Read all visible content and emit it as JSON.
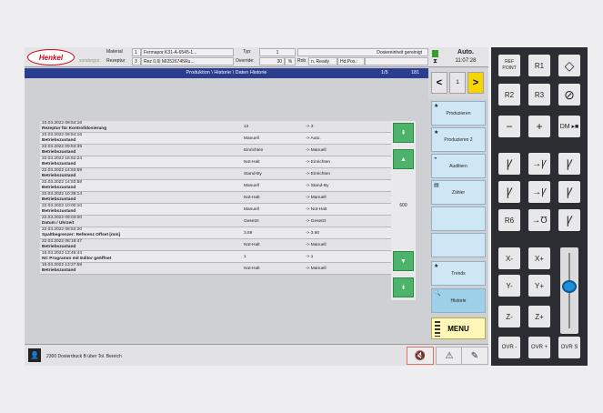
{
  "brand": {
    "logo": "Henkel",
    "sub": "sondergut"
  },
  "header": {
    "material_label": "Material",
    "material_no": "1",
    "material_value": "Fermapor K31-A-6545-1...",
    "recipe_label": "Rezeptur",
    "recipe_no": "3",
    "recipe_value": "Rez 0,6| MI2526745Ru...",
    "type_label": "Typ:",
    "type_value": "1",
    "override_label": "Override:",
    "override_value": "30",
    "override_unit": "%",
    "rob": "Rob",
    "ready": "n. Ready",
    "hd": "Hd.Pos.:",
    "dosing_state": "Dosiereinheit gereinigt",
    "mode": "Auto.",
    "clock": "11:07:28"
  },
  "titlebar": {
    "title": "Produktion \\ Historie \\ Daten Historie",
    "page": "1/5",
    "count": "181"
  },
  "pager": {
    "prev": "<",
    "page": "1",
    "next": ">"
  },
  "rows": [
    {
      "date": "23.03.2022 09:54:16",
      "event": "Rezeptur für Kontrolldosierung",
      "v1": "12",
      "v2": "-> 3"
    },
    {
      "date": "23.03.2022 09:54:16",
      "event": "Betriebszustand",
      "v1": "Manuell",
      "v2": "-> Auto."
    },
    {
      "date": "23.03.2022 09:53:39",
      "event": "Betriebszustand",
      "v1": "Einrichten",
      "v2": "-> Manuell"
    },
    {
      "date": "22.03.2022 16:52:24",
      "event": "Betriebszustand",
      "v1": "Not-Halt",
      "v2": "-> Einrichten"
    },
    {
      "date": "22.03.2022 14:53:59",
      "event": "Betriebszustand",
      "v1": "Stand-By",
      "v2": "-> Einrichten"
    },
    {
      "date": "22.03.2022 14:53:58",
      "event": "Betriebszustand",
      "v1": "Manuell",
      "v2": "-> Stand-By"
    },
    {
      "date": "22.03.2022 10:39:14",
      "event": "Betriebszustand",
      "v1": "Not-Halt",
      "v2": "-> Manuell"
    },
    {
      "date": "22.03.2022 10:00:10",
      "event": "Betriebszustand",
      "v1": "Manuell",
      "v2": "-> Not-Halt"
    },
    {
      "date": "22.03.2022 09:03:00",
      "event": "Datum / Uhrzeit",
      "v1": "Gesetzt",
      "v2": "-> Gesetzt"
    },
    {
      "date": "22.03.2022 08:53:20",
      "event": "Spaltbegrenzer: Referenz Offset [mm]",
      "v1": "3.59",
      "v2": "-> 3.60"
    },
    {
      "date": "22.03.2022 08:18:47",
      "event": "Betriebszustand",
      "v1": "Not-Halt",
      "v2": "-> Manuell"
    },
    {
      "date": "15.03.2022 13:45:44",
      "event": "NC Programm mit Editor geöffnet",
      "v1": "1",
      "v2": "-> 1"
    },
    {
      "date": "15.03.2022 13:27:58",
      "event": "Betriebszustand",
      "v1": "Not-Halt",
      "v2": "-> Manuell"
    }
  ],
  "scroll": {
    "value": "600"
  },
  "sidebar": [
    {
      "label": "Produzieren",
      "icon": "★"
    },
    {
      "label": "Produzieren 2",
      "icon": "★"
    },
    {
      "label": "Auditiern",
      "icon": "◒"
    },
    {
      "label": "Zähler",
      "icon": "▤"
    },
    {
      "label": "",
      "icon": ""
    },
    {
      "label": "",
      "icon": ""
    },
    {
      "label": "Trends",
      "icon": "★"
    },
    {
      "label": "Historie",
      "icon": "🔍"
    }
  ],
  "menu": {
    "label": "MENU"
  },
  "bottom": {
    "message": "2300 Dosierdruck B über Tol. Bereich"
  },
  "keypad": {
    "r1": [
      "REF POINT",
      "R1",
      "◇"
    ],
    "r2": [
      "R2",
      "R3",
      "⊘"
    ],
    "r3": [
      "−",
      "+",
      "DM ▸■"
    ],
    "r6": "R6",
    "x": [
      "X-",
      "X+"
    ],
    "y": [
      "Y-",
      "Y+"
    ],
    "z": [
      "Z-",
      "Z+"
    ],
    "ovr": [
      "OVR -",
      "OVR +",
      "OVR S"
    ]
  },
  "slider": {
    "level": 0.55
  }
}
